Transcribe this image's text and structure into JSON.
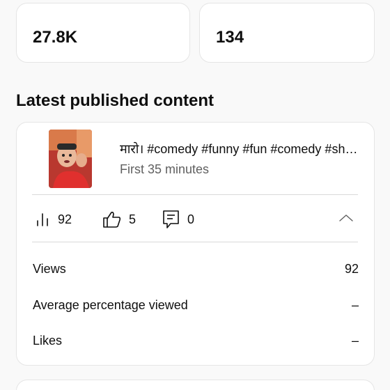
{
  "stats": [
    {
      "value": "27.8K"
    },
    {
      "value": "134"
    }
  ],
  "section": {
    "title": "Latest published content"
  },
  "latest_video": {
    "title": "मारो। #comedy #funny #fun #comedy #shorts",
    "subtitle": "First 35 minutes",
    "metrics": {
      "views": "92",
      "likes": "5",
      "comments": "0"
    },
    "details": [
      {
        "label": "Views",
        "value": "92"
      },
      {
        "label": "Average percentage viewed",
        "value": "–"
      },
      {
        "label": "Likes",
        "value": "–"
      }
    ]
  },
  "icons": {
    "views": "bar-chart-icon",
    "likes": "thumbs-up-icon",
    "comments": "comment-icon",
    "collapse": "chevron-up-icon"
  },
  "colors": {
    "background": "#f9f9f9",
    "card": "#ffffff",
    "primary_text": "#0f0f0f",
    "secondary_text": "#606060"
  }
}
